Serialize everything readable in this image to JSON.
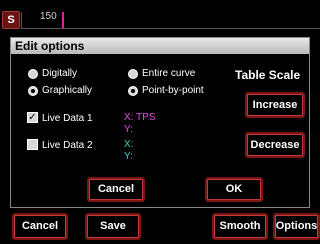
{
  "topbar": {
    "badge": "S",
    "ruler_value": "150"
  },
  "dialog": {
    "title": "Edit options",
    "mode": {
      "digitally": "Digitally",
      "graphically": "Graphically",
      "selected": "Graphically"
    },
    "range": {
      "entire_curve": "Entire curve",
      "point_by_point": "Point-by-point",
      "selected": "Point-by-point"
    },
    "table_scale": "Table Scale",
    "increase": "Increase",
    "decrease": "Decrease",
    "live_data_1": {
      "label": "Live Data 1",
      "checked": true,
      "x": "X: TPS",
      "y": "Y:"
    },
    "live_data_2": {
      "label": "Live Data 2",
      "checked": false,
      "x": "X:",
      "y": "Y:"
    },
    "cancel": "Cancel",
    "ok": "OK"
  },
  "toolbar": {
    "cancel": "Cancel",
    "save": "Save",
    "smooth": "Smooth",
    "options": "Options"
  },
  "colors": {
    "accent_border": "#7a1515",
    "live1_text": "#e44fe4",
    "live2_text": "#2fd6d6"
  }
}
